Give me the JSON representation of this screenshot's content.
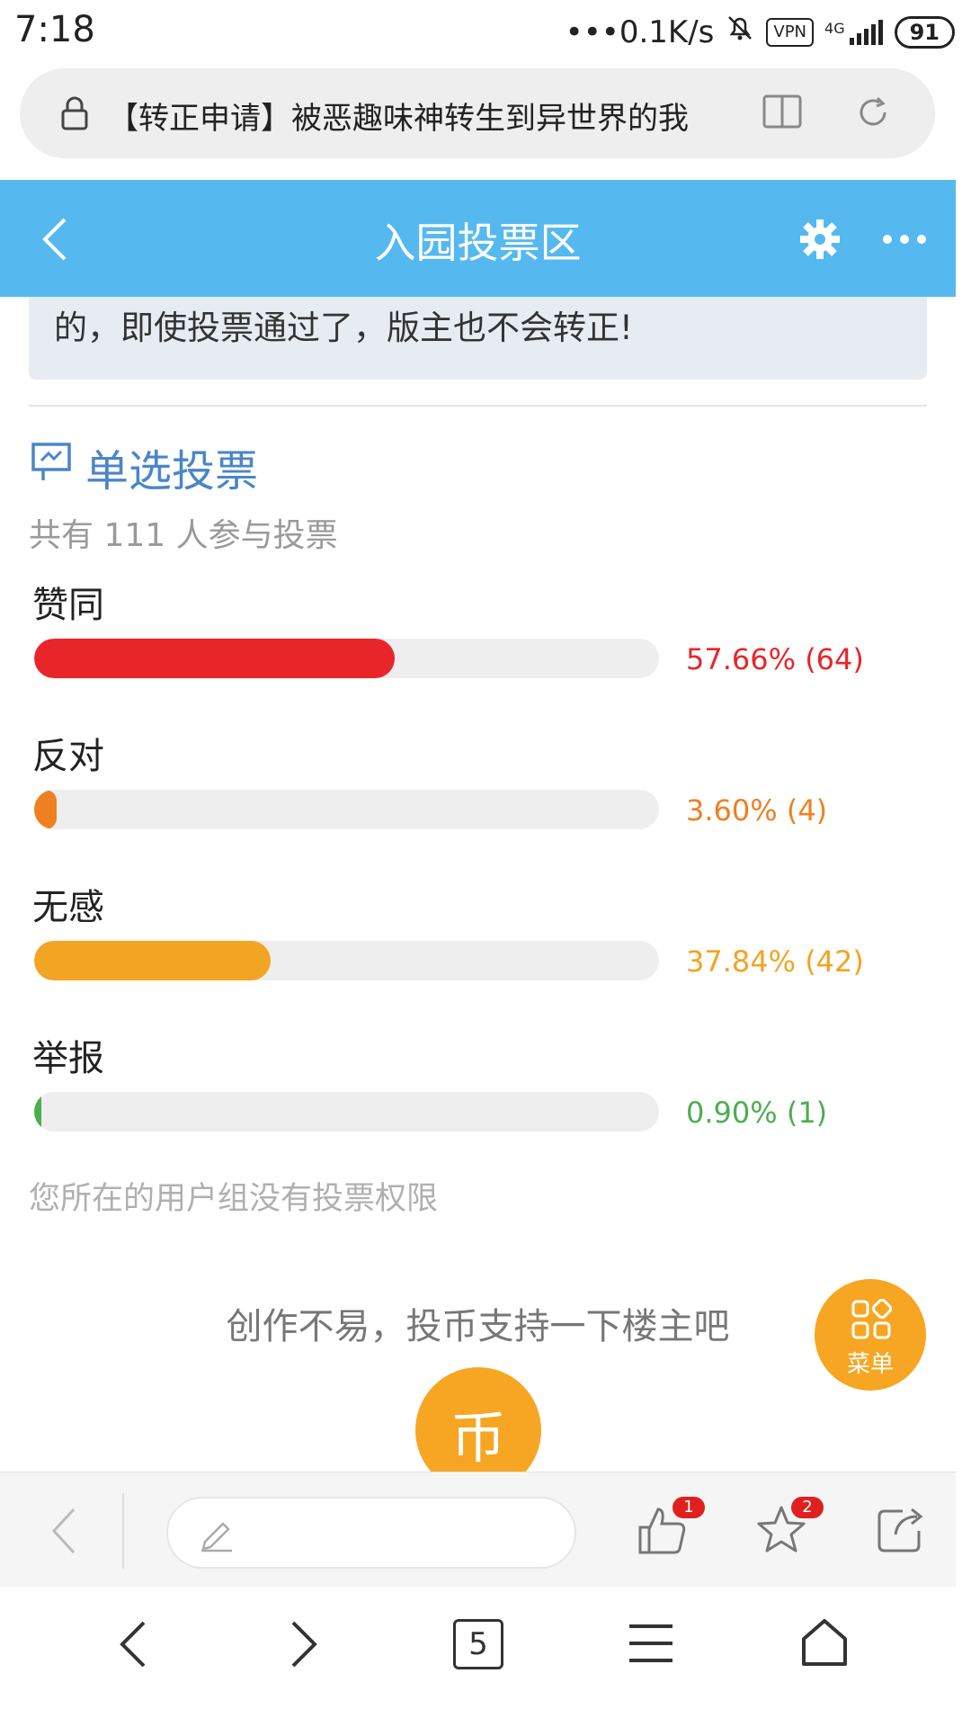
{
  "status_bar": {
    "time": "7:18",
    "network_speed": "•••0.1K/s",
    "vpn": "VPN",
    "signal": "4G",
    "battery": "91"
  },
  "browser": {
    "address_text": "【转正申请】被恶趣味神转生到异世界的我"
  },
  "header": {
    "title": "入园投票区"
  },
  "notice": {
    "text": "的，即使投票通过了，版主也不会转正!"
  },
  "poll": {
    "title": "单选投票",
    "participants": "共有 111 人参与投票",
    "options": [
      {
        "label": "赞同",
        "result": "57.66% (64)",
        "fraction": 0.5766,
        "color": "#e8262a"
      },
      {
        "label": "反对",
        "result": "3.60% (4)",
        "fraction": 0.036,
        "color": "#f07f22"
      },
      {
        "label": "无感",
        "result": "37.84% (42)",
        "fraction": 0.3784,
        "color": "#f2a422"
      },
      {
        "label": "举报",
        "result": "0.90% (1)",
        "fraction": 0.009,
        "color": "#4cae4f"
      }
    ],
    "permission_note": "您所在的用户组没有投票权限"
  },
  "coin": {
    "prompt": "创作不易，投币支持一下楼主吧",
    "button_label": "币"
  },
  "menu_fab": {
    "label": "菜单"
  },
  "action_bar": {
    "like_count": "1",
    "favorite_count": "2"
  },
  "system_nav": {
    "tab_count": "5"
  }
}
